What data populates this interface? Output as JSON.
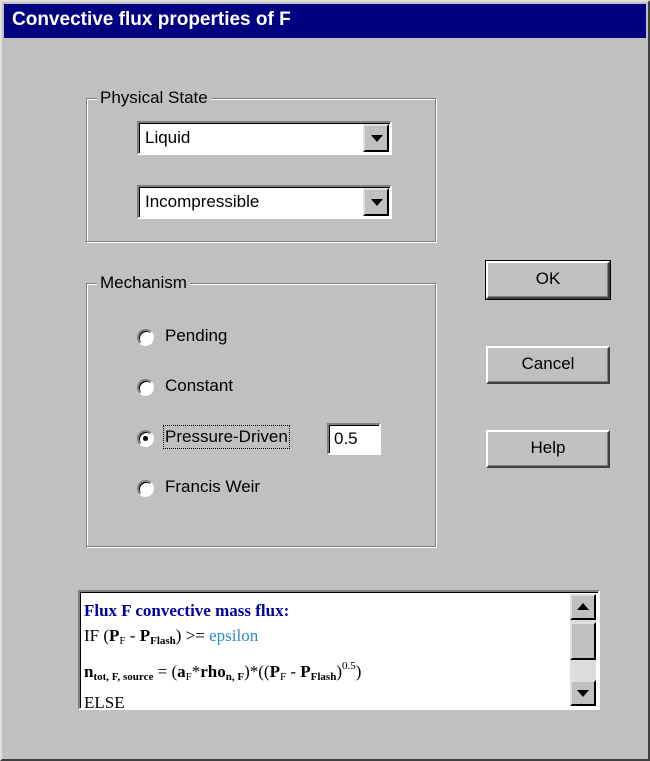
{
  "window": {
    "title": "Convective flux properties of F"
  },
  "physical_state": {
    "label": "Physical State",
    "state_select": {
      "value": "Liquid"
    },
    "compressibility_select": {
      "value": "Incompressible"
    }
  },
  "mechanism": {
    "label": "Mechanism",
    "options": [
      {
        "label": "Pending",
        "checked": false
      },
      {
        "label": "Constant",
        "checked": false
      },
      {
        "label": "Pressure-Driven",
        "checked": true
      },
      {
        "label": "Francis Weir",
        "checked": false
      }
    ],
    "pressure_coefficient": "0.5"
  },
  "buttons": {
    "ok": "OK",
    "cancel": "Cancel",
    "help": "Help"
  },
  "equation": {
    "heading": "Flux F convective mass flux:",
    "if_prefix": "IF (",
    "P": "P",
    "sub_F": "F",
    "minus": " - ",
    "sub_flash": "Flash",
    "compare": ") >= ",
    "epsilon": "epsilon",
    "n": "n",
    "sub_tot": "tot, F, source",
    "eq_open": " = (",
    "a": "a",
    "times": "*",
    "rho": "rho",
    "sub_n_f": "n, F",
    "mid": ")*((",
    "close": ")",
    "exponent": "0.5",
    "end_paren": ")",
    "else": "ELSE"
  }
}
